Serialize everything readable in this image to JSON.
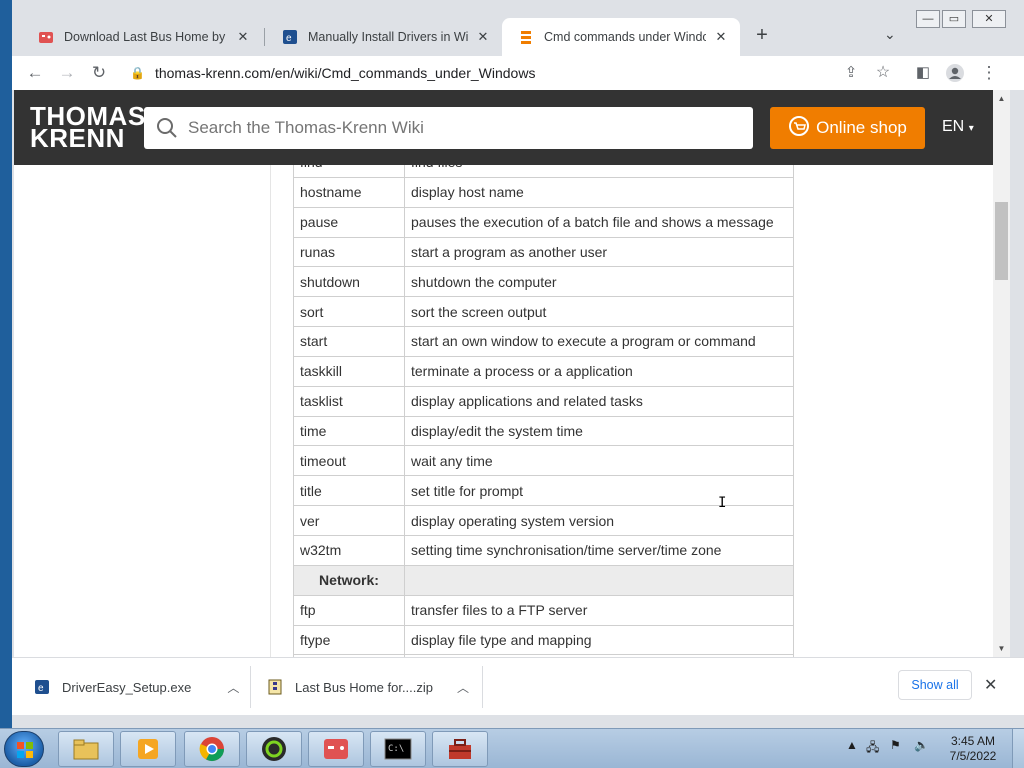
{
  "browser": {
    "tabs": [
      {
        "title": "Download Last Bus Home by maj",
        "active": false,
        "favicon": "game-icon"
      },
      {
        "title": "Manually Install Drivers in Windo",
        "active": false,
        "favicon": "drivereasy-icon"
      },
      {
        "title": "Cmd commands under Windows",
        "active": true,
        "favicon": "thomas-krenn-icon"
      }
    ],
    "url": "thomas-krenn.com/en/wiki/Cmd_commands_under_Windows"
  },
  "site": {
    "logo_line1": "THOMAS",
    "logo_line2": "KRENN",
    "search_placeholder": "Search the Thomas-Krenn Wiki",
    "shop_label": "Online shop",
    "lang_label": "EN"
  },
  "table": {
    "rows": [
      {
        "cmd": "find",
        "desc": "find files",
        "section": false
      },
      {
        "cmd": "hostname",
        "desc": "display host name",
        "section": false
      },
      {
        "cmd": "pause",
        "desc": "pauses the execution of a batch file and shows a message",
        "section": false
      },
      {
        "cmd": "runas",
        "desc": "start a program as another user",
        "section": false
      },
      {
        "cmd": "shutdown",
        "desc": "shutdown the computer",
        "section": false
      },
      {
        "cmd": "sort",
        "desc": "sort the screen output",
        "section": false
      },
      {
        "cmd": "start",
        "desc": "start an own window to execute a program or command",
        "section": false
      },
      {
        "cmd": "taskkill",
        "desc": "terminate a process or a application",
        "section": false
      },
      {
        "cmd": "tasklist",
        "desc": "display applications and related tasks",
        "section": false
      },
      {
        "cmd": "time",
        "desc": "display/edit the system time",
        "section": false
      },
      {
        "cmd": "timeout",
        "desc": "wait any time",
        "section": false
      },
      {
        "cmd": "title",
        "desc": "set title for prompt",
        "section": false
      },
      {
        "cmd": "ver",
        "desc": "display operating system version",
        "section": false
      },
      {
        "cmd": "w32tm",
        "desc": "setting time synchronisation/time server/time zone",
        "section": false
      },
      {
        "cmd": "Network:",
        "desc": "",
        "section": true
      },
      {
        "cmd": "ftp",
        "desc": "transfer files to a FTP server",
        "section": false
      },
      {
        "cmd": "ftype",
        "desc": "display file type and mapping",
        "section": false
      },
      {
        "cmd": "",
        "desc": "",
        "section": false
      }
    ]
  },
  "downloads": {
    "items": [
      {
        "name": "DriverEasy_Setup.exe",
        "icon": "drivereasy-icon"
      },
      {
        "name": "Last Bus Home for....zip",
        "icon": "zip-archive-icon"
      }
    ],
    "show_all_label": "Show all"
  },
  "taskbar": {
    "time": "3:45 AM",
    "date": "7/5/2022"
  },
  "colors": {
    "header_bg": "#333333",
    "shop_orange": "#f07d00",
    "link_blue": "#1a73e8"
  }
}
